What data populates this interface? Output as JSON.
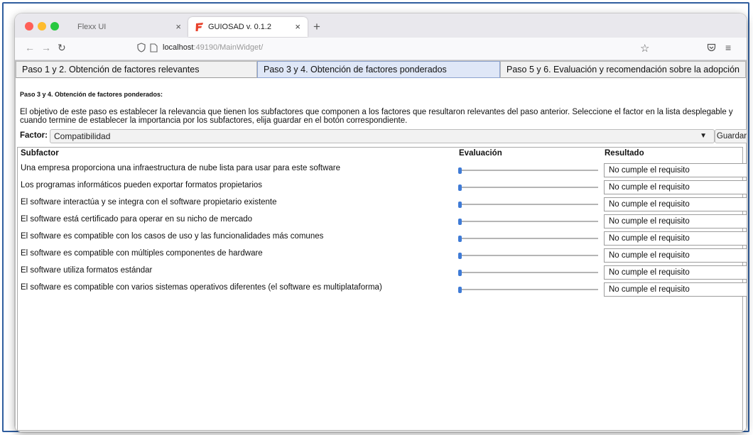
{
  "browser": {
    "tabs": [
      {
        "title": "Flexx UI",
        "close": "×"
      },
      {
        "title": "GUIOSAD v. 0.1.2",
        "close": "×"
      }
    ],
    "new_tab": "+",
    "url_host": "localhost",
    "url_rest": ":49190/MainWidget/"
  },
  "app_tabs": [
    {
      "label": "Paso 1 y 2. Obtención de factores relevantes"
    },
    {
      "label": "Paso 3 y 4. Obtención de factores ponderados"
    },
    {
      "label": "Paso 5 y 6. Evaluación y recomendación sobre la adopción"
    }
  ],
  "main": {
    "heading": "Paso 3 y 4. Obtención de factores ponderados:",
    "description": "El objetivo de este paso es establecer la relevancia que tienen los subfactores que componen a los factores que resultaron relevantes del paso anterior. Seleccione el factor en la lista desplegable y cuando termine de establecer la importancia por los subfactores, elija guardar en el botón correspondiente.",
    "factor_label": "Factor:",
    "factor_value": "Compatibilidad",
    "save_label": "Guardar"
  },
  "table": {
    "headers": {
      "subfactor": "Subfactor",
      "evaluacion": "Evaluación",
      "resultado": "Resultado"
    },
    "rows": [
      {
        "subfactor": "Una empresa proporciona una infraestructura de nube lista para usar para este software",
        "evaluacion": 0,
        "resultado": "No cumple el requisito"
      },
      {
        "subfactor": "Los programas informáticos pueden exportar formatos propietarios",
        "evaluacion": 0,
        "resultado": "No cumple el requisito"
      },
      {
        "subfactor": "El software interactúa y se integra con el software propietario existente",
        "evaluacion": 0,
        "resultado": "No cumple el requisito"
      },
      {
        "subfactor": "El software está certificado para operar en su nicho de mercado",
        "evaluacion": 0,
        "resultado": "No cumple el requisito"
      },
      {
        "subfactor": "El software es compatible con los casos de uso y las funcionalidades más comunes",
        "evaluacion": 0,
        "resultado": "No cumple el requisito"
      },
      {
        "subfactor": "El software es compatible con múltiples componentes de hardware",
        "evaluacion": 0,
        "resultado": "No cumple el requisito"
      },
      {
        "subfactor": "El software utiliza formatos estándar",
        "evaluacion": 0,
        "resultado": "No cumple el requisito"
      },
      {
        "subfactor": "El software es compatible con varios sistemas operativos diferentes (el software es multiplataforma)",
        "evaluacion": 0,
        "resultado": "No cumple el requisito"
      }
    ]
  },
  "colors": {
    "accent": "#3f7bd6",
    "active_tab": "#dfe7f7",
    "favicon": "#e8412c"
  }
}
